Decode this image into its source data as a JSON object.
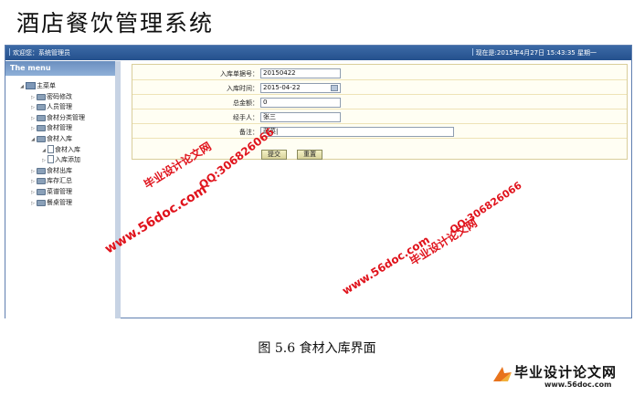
{
  "app": {
    "title": "酒店餐饮管理系统"
  },
  "topbar": {
    "welcome": "欢迎您：系统管理员",
    "clock": "现在是:2015年4月27日 15:43:35 星期一"
  },
  "sidebar": {
    "header": "The menu",
    "items": [
      {
        "label": "主菜单",
        "level": 0,
        "toggle": "◢"
      },
      {
        "label": "密码修改",
        "level": 1,
        "toggle": "▷"
      },
      {
        "label": "人员管理",
        "level": 1,
        "toggle": "▷"
      },
      {
        "label": "食材分类管理",
        "level": 1,
        "toggle": "▷"
      },
      {
        "label": "食材管理",
        "level": 1,
        "toggle": "▷"
      },
      {
        "label": "食材入库",
        "level": 1,
        "toggle": "◢"
      },
      {
        "label": "食材入库",
        "level": 2,
        "toggle": "◢"
      },
      {
        "label": "入库添加",
        "level": 2,
        "toggle": "▷"
      },
      {
        "label": "食材出库",
        "level": 1,
        "toggle": "▷"
      },
      {
        "label": "库存汇总",
        "level": 1,
        "toggle": "▷"
      },
      {
        "label": "菜谱管理",
        "level": 1,
        "toggle": "▷"
      },
      {
        "label": "餐桌管理",
        "level": 1,
        "toggle": "▷"
      }
    ]
  },
  "form": {
    "fields": [
      {
        "label": "入库单据号：",
        "value": "20150422"
      },
      {
        "label": "入库时间：",
        "value": "2015-04-22"
      },
      {
        "label": "总金额：",
        "value": "0"
      },
      {
        "label": "经手人：",
        "value": "张三"
      },
      {
        "label": "备注：",
        "value": "蔬菜|"
      }
    ],
    "submit_label": "提交",
    "reset_label": "重置"
  },
  "watermarks": {
    "url": "www.56doc.com",
    "qq": "QQ:306826066",
    "brand": "毕业设计论文网"
  },
  "caption": "图 5.6  食材入库界面",
  "logo": {
    "text": "毕业设计论文网",
    "url": "www.56doc.com"
  }
}
